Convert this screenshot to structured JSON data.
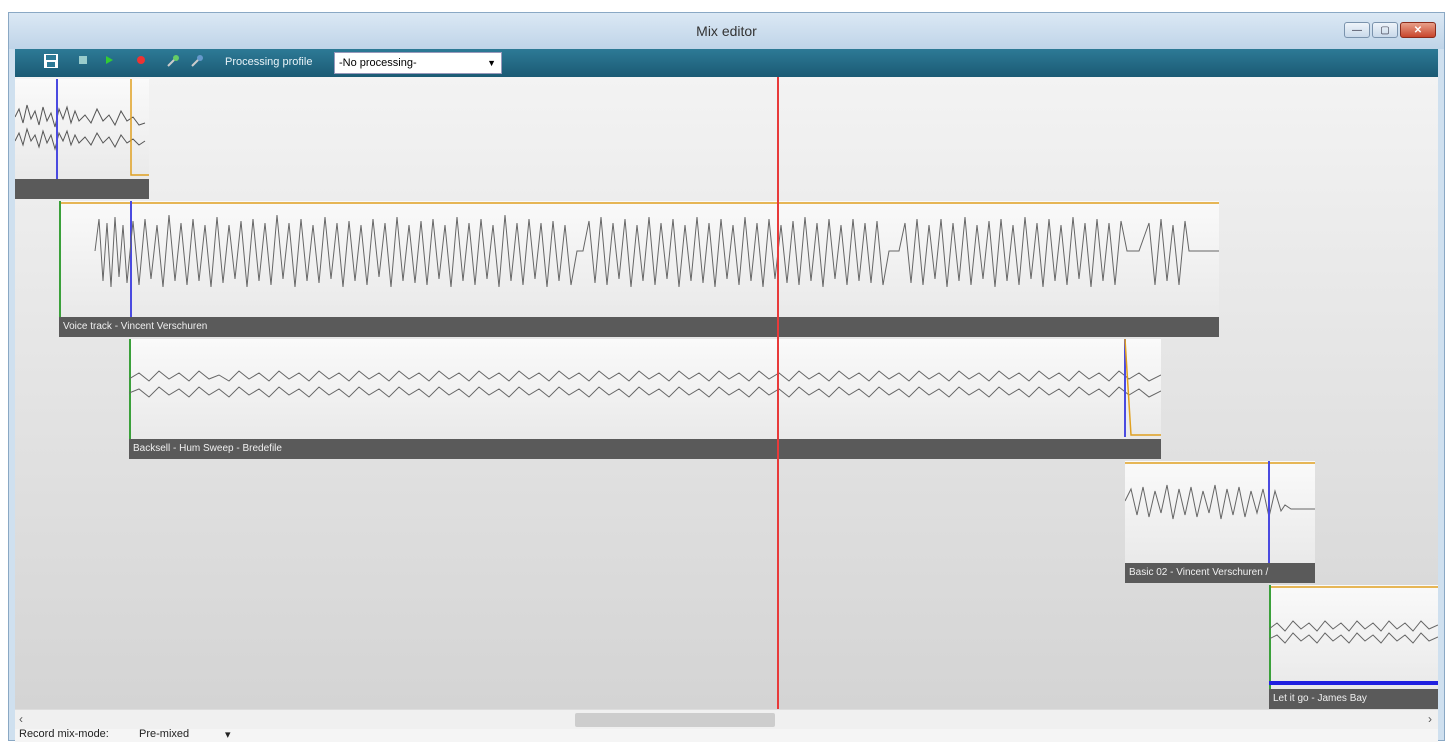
{
  "window": {
    "title": "Mix editor",
    "minimize": "—",
    "maximize": "▢",
    "close": "✕"
  },
  "toolbar": {
    "save_icon": "save-icon",
    "stop_icon": "stop-icon",
    "play_icon": "play-icon",
    "record_icon": "record-icon",
    "probe1_icon": "microphone-icon",
    "probe2_icon": "microphone-icon",
    "processing_label": "Processing profile",
    "processing_value": "-No processing-"
  },
  "tracks": [
    {
      "label": ""
    },
    {
      "label": "Voice track - Vincent Verschuren"
    },
    {
      "label": "Backsell - Hum Sweep - Bredefile"
    },
    {
      "label": "Basic 02 - Vincent Verschuren /"
    },
    {
      "label": "Let it go - James Bay"
    }
  ],
  "colors": {
    "playhead": "#e83a3a",
    "marker": "#4a4ae0",
    "fade": "#e0a020",
    "start": "#3aa03a"
  },
  "status": {
    "label": "Record mix-mode:",
    "value": "Pre-mixed",
    "arrow": "▾"
  },
  "scroll": {
    "left": "‹",
    "right": "›"
  }
}
